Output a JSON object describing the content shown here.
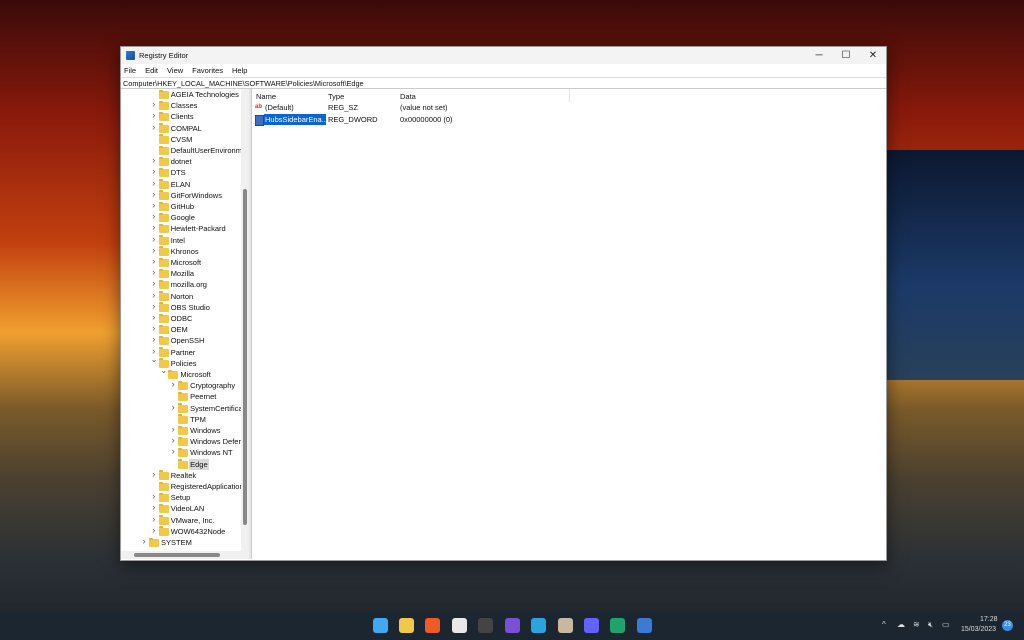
{
  "window": {
    "title": "Registry Editor",
    "minimize": "─",
    "maximize": "☐",
    "close": "✕"
  },
  "menu": [
    "File",
    "Edit",
    "View",
    "Favorites",
    "Help"
  ],
  "address": "Computer\\HKEY_LOCAL_MACHINE\\SOFTWARE\\Policies\\Microsoft\\Edge",
  "tree": [
    {
      "label": "AGEIA Technologies",
      "level": 1,
      "exp": ""
    },
    {
      "label": "Classes",
      "level": 1,
      "exp": ">"
    },
    {
      "label": "Clients",
      "level": 1,
      "exp": ">"
    },
    {
      "label": "COMPAL",
      "level": 1,
      "exp": ">"
    },
    {
      "label": "CVSM",
      "level": 1,
      "exp": ""
    },
    {
      "label": "DefaultUserEnvironme",
      "level": 1,
      "exp": ""
    },
    {
      "label": "dotnet",
      "level": 1,
      "exp": ">"
    },
    {
      "label": "DTS",
      "level": 1,
      "exp": ">"
    },
    {
      "label": "ELAN",
      "level": 1,
      "exp": ">"
    },
    {
      "label": "GitForWindows",
      "level": 1,
      "exp": ">"
    },
    {
      "label": "GitHub",
      "level": 1,
      "exp": ">"
    },
    {
      "label": "Google",
      "level": 1,
      "exp": ">"
    },
    {
      "label": "Hewlett-Packard",
      "level": 1,
      "exp": ">"
    },
    {
      "label": "Intel",
      "level": 1,
      "exp": ">"
    },
    {
      "label": "Khronos",
      "level": 1,
      "exp": ">"
    },
    {
      "label": "Microsoft",
      "level": 1,
      "exp": ">"
    },
    {
      "label": "Mozilla",
      "level": 1,
      "exp": ">"
    },
    {
      "label": "mozilla.org",
      "level": 1,
      "exp": ">"
    },
    {
      "label": "Norton",
      "level": 1,
      "exp": ">"
    },
    {
      "label": "OBS Studio",
      "level": 1,
      "exp": ">"
    },
    {
      "label": "ODBC",
      "level": 1,
      "exp": ">"
    },
    {
      "label": "OEM",
      "level": 1,
      "exp": ">"
    },
    {
      "label": "OpenSSH",
      "level": 1,
      "exp": ">"
    },
    {
      "label": "Partner",
      "level": 1,
      "exp": ">"
    },
    {
      "label": "Policies",
      "level": 1,
      "exp": "v"
    },
    {
      "label": "Microsoft",
      "level": 2,
      "exp": "v"
    },
    {
      "label": "Cryptography",
      "level": 3,
      "exp": ">"
    },
    {
      "label": "Peernet",
      "level": 3,
      "exp": ""
    },
    {
      "label": "SystemCertificat",
      "level": 3,
      "exp": ">"
    },
    {
      "label": "TPM",
      "level": 3,
      "exp": ""
    },
    {
      "label": "Windows",
      "level": 3,
      "exp": ">"
    },
    {
      "label": "Windows Defer",
      "level": 3,
      "exp": ">"
    },
    {
      "label": "Windows NT",
      "level": 3,
      "exp": ">"
    },
    {
      "label": "Edge",
      "level": 3,
      "exp": "",
      "selected": true
    },
    {
      "label": "Realtek",
      "level": 1,
      "exp": ">"
    },
    {
      "label": "RegisteredApplication",
      "level": 1,
      "exp": ""
    },
    {
      "label": "Setup",
      "level": 1,
      "exp": ">"
    },
    {
      "label": "VideoLAN",
      "level": 1,
      "exp": ">"
    },
    {
      "label": "VMware, Inc.",
      "level": 1,
      "exp": ">"
    },
    {
      "label": "WOW6432Node",
      "level": 1,
      "exp": ">"
    },
    {
      "label": "SYSTEM",
      "level": 0,
      "exp": ">"
    }
  ],
  "list": {
    "columns": [
      "Name",
      "Type",
      "Data"
    ],
    "rows": [
      {
        "name": "(Default)",
        "type": "REG_SZ",
        "data": "(value not set)",
        "icon": "string-value-icon"
      },
      {
        "name": "HubsSidebarEna...",
        "type": "REG_DWORD",
        "data": "0x00000000 (0)",
        "icon": "binary-value-icon",
        "selected": true
      }
    ]
  },
  "taskbar": {
    "time": "17:28",
    "date": "15/03/2023",
    "badge": "23",
    "apps": [
      {
        "name": "start",
        "color": "#3fa9f5"
      },
      {
        "name": "file-explorer",
        "color": "#f2c84b"
      },
      {
        "name": "brave",
        "color": "#f05a24"
      },
      {
        "name": "store",
        "color": "#e8e8e8"
      },
      {
        "name": "terminal",
        "color": "#444"
      },
      {
        "name": "obsidian",
        "color": "#7b4fd6"
      },
      {
        "name": "telegram",
        "color": "#2aa3df"
      },
      {
        "name": "regedit",
        "color": "#c8b8a0"
      },
      {
        "name": "mastodon",
        "color": "#6364ff"
      },
      {
        "name": "edge-dev",
        "color": "#1fa36a"
      },
      {
        "name": "app",
        "color": "#3a7bd5"
      }
    ]
  }
}
